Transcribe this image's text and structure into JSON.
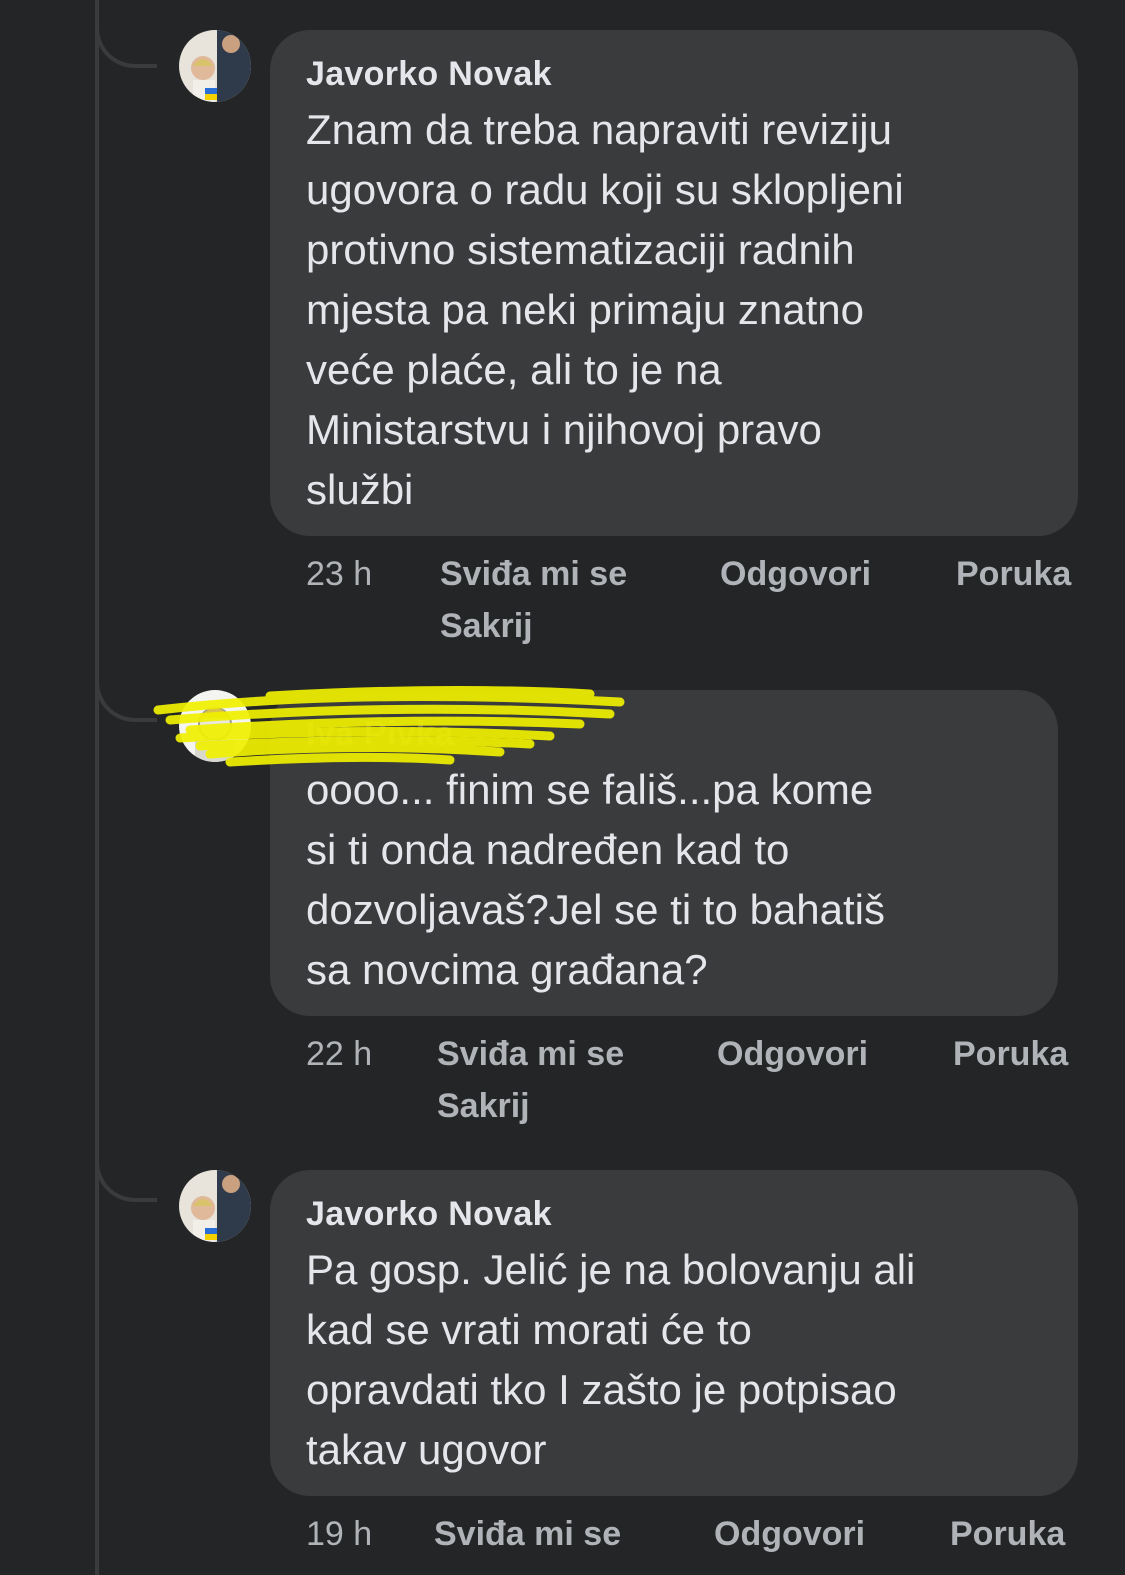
{
  "comments": [
    {
      "author": "Javorko Novak",
      "text": "Znam da treba napraviti reviziju\nugovora o radu koji su sklopljeni\nprotivno sistematizaciji radnih\nmjesta pa neki primaju znatno\nveće plaće, ali to je na\nMinistarstvu i njihovoj pravo\nslužbi",
      "time": "23 h",
      "like": "Sviđa mi se",
      "reply": "Odgovori",
      "message": "Poruka",
      "hide": "Sakrij"
    },
    {
      "author": "Iva Pivka",
      "text": "oooo... finim se fališ...pa kome\nsi ti onda nadređen kad to\ndozvoljavaš?Jel se ti to bahatiš\nsa novcima građana?",
      "time": "22 h",
      "like": "Sviđa mi se",
      "reply": "Odgovori",
      "message": "Poruka",
      "hide": "Sakrij"
    },
    {
      "author": "Javorko Novak",
      "text": "Pa gosp. Jelić je na bolovanju ali\nkad se vrati morati će to\nopravdati tko I zašto je potpisao\ntakav ugovor",
      "time": "19 h",
      "like": "Sviđa mi se",
      "reply": "Odgovori",
      "message": "Poruka"
    }
  ],
  "colors": {
    "background": "#242526",
    "bubble": "#3a3b3c",
    "text": "#e4e6eb",
    "secondary": "#b0b3b8",
    "redaction": "#f0f000"
  },
  "icons": {
    "avatar": "profile-photo",
    "flag": "ukraine-flag-badge"
  }
}
